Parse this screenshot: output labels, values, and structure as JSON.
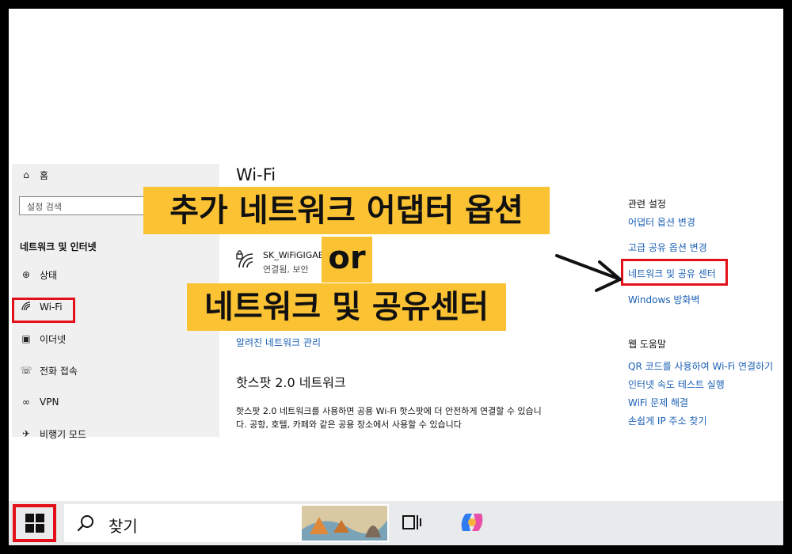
{
  "sidebar": {
    "home_label": "홈",
    "search_placeholder": "설정 검색",
    "heading": "네트워크 및 인터넷",
    "items": [
      {
        "label": "상태",
        "icon": "globe-icon"
      },
      {
        "label": "Wi-Fi",
        "icon": "wifi-icon"
      },
      {
        "label": "이더넷",
        "icon": "ethernet-icon"
      },
      {
        "label": "전화 접속",
        "icon": "dialup-icon"
      },
      {
        "label": "VPN",
        "icon": "vpn-icon"
      },
      {
        "label": "비행기 모드",
        "icon": "airplane-icon"
      }
    ]
  },
  "main": {
    "title": "Wi-Fi",
    "network": {
      "name": "SK_WiFiGIGAE",
      "status": "연결됨, 보안"
    },
    "known_networks_link": "알려진 네트워크 관리",
    "hotspot_title": "핫스팟 2.0 네트워크",
    "hotspot_text": "핫스팟 2.0 네트워크를 사용하면 공용 Wi-Fi 핫스팟에 더 안전하게 연결할 수 있습니다. 공항, 호텔, 카페와 같은 공용 장소에서 사용할 수 있습니다"
  },
  "related": {
    "heading": "관련 설정",
    "links": [
      "어댑터 옵션 변경",
      "고급 공유 옵션 변경",
      "네트워크 및 공유 센터",
      "Windows 방화벽"
    ]
  },
  "help": {
    "heading": "웹 도움말",
    "links": [
      "QR 코드를 사용하여 Wi-Fi 연결하기",
      "인터넷 속도 테스트 실행",
      "WiFi 문제 해결",
      "손쉽게 IP 주소 찾기"
    ]
  },
  "overlay": {
    "line1": "추가 네트워크 어댑터 옵션",
    "line2": "or",
    "line3": "네트워크 및 공유센터"
  },
  "taskbar": {
    "search_label": "찾기"
  },
  "colors": {
    "highlight": "#fbc233",
    "annotation_red": "#e3101a",
    "link_blue": "#1a5fb4"
  }
}
